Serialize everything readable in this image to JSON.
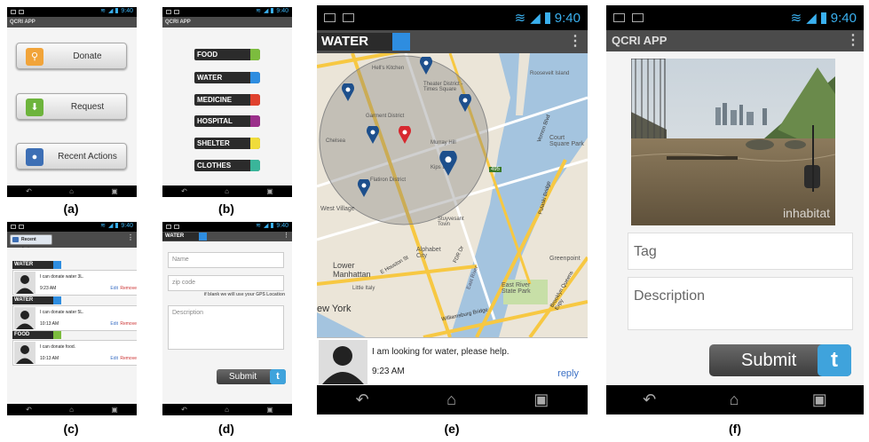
{
  "captions": {
    "a": "(a)",
    "b": "(b)",
    "c": "(c)",
    "d": "(d)",
    "e": "(e)",
    "f": "(f)"
  },
  "status_time": "9:40",
  "app_title": "QCRI APP",
  "screen_a": {
    "buttons": [
      {
        "label": "Donate",
        "icon": "search-icon",
        "color": "#f1a43a"
      },
      {
        "label": "Request",
        "icon": "download-arrow-icon",
        "color": "#6db43c"
      },
      {
        "label": "Recent Actions",
        "icon": "speech-bubble-icon",
        "color": "#3d6fb5"
      }
    ]
  },
  "screen_b": {
    "categories": [
      {
        "label": "FOOD",
        "color": "#7cbc3e"
      },
      {
        "label": "WATER",
        "color": "#2e8de0"
      },
      {
        "label": "MEDICINE",
        "color": "#e0412e"
      },
      {
        "label": "HOSPITAL",
        "color": "#9b2f8a"
      },
      {
        "label": "SHELTER",
        "color": "#f0dc3a"
      },
      {
        "label": "CLOTHES",
        "color": "#3ab59a"
      }
    ]
  },
  "screen_c": {
    "header": "Recent Actions",
    "posts": [
      {
        "category": "WATER",
        "color": "#2e8de0",
        "message": "I can donate water 3L.",
        "time": "9:23 AM",
        "edit": "Edit",
        "remove": "Remove"
      },
      {
        "category": "WATER",
        "color": "#2e8de0",
        "message": "I can donate water 5L.",
        "time": "10:13 AM",
        "edit": "Edit",
        "remove": "Remove"
      },
      {
        "category": "FOOD",
        "color": "#7cbc3e",
        "message": "I can donate food.",
        "time": "10:13 AM",
        "edit": "Edit",
        "remove": "Remove"
      }
    ]
  },
  "screen_d": {
    "category": "WATER",
    "name_placeholder": "Name",
    "zip_placeholder": "zip code",
    "zip_hint": "if blank we will use your GPS Location",
    "description_placeholder": "Description",
    "submit": "Submit"
  },
  "screen_e": {
    "category": "WATER",
    "map_labels": [
      "Hell's Kitchen",
      "Theater District - Times Square",
      "Garment District",
      "Murray Hill",
      "Kips Bay",
      "Flatiron District",
      "Chelsea",
      "West Village",
      "Roosevelt Island",
      "Court Square Park",
      "Alphabet City",
      "Lower Manhattan",
      "Little Italy",
      "Stuyvesant Town",
      "Greenpoint",
      "East River State Park",
      "ew York",
      "495",
      "FDR Dr",
      "E Houston St",
      "Williamsburg Bridge",
      "East River",
      "Pulaski Bridge",
      "Vernon Blvd",
      "Brooklyn Queens Expy"
    ],
    "message": "I am looking for water, please help.",
    "time": "9:23 AM",
    "reply": "reply"
  },
  "screen_f": {
    "watermark": "inhabitat",
    "tag_placeholder": "Tag",
    "description_placeholder": "Description",
    "submit": "Submit"
  }
}
